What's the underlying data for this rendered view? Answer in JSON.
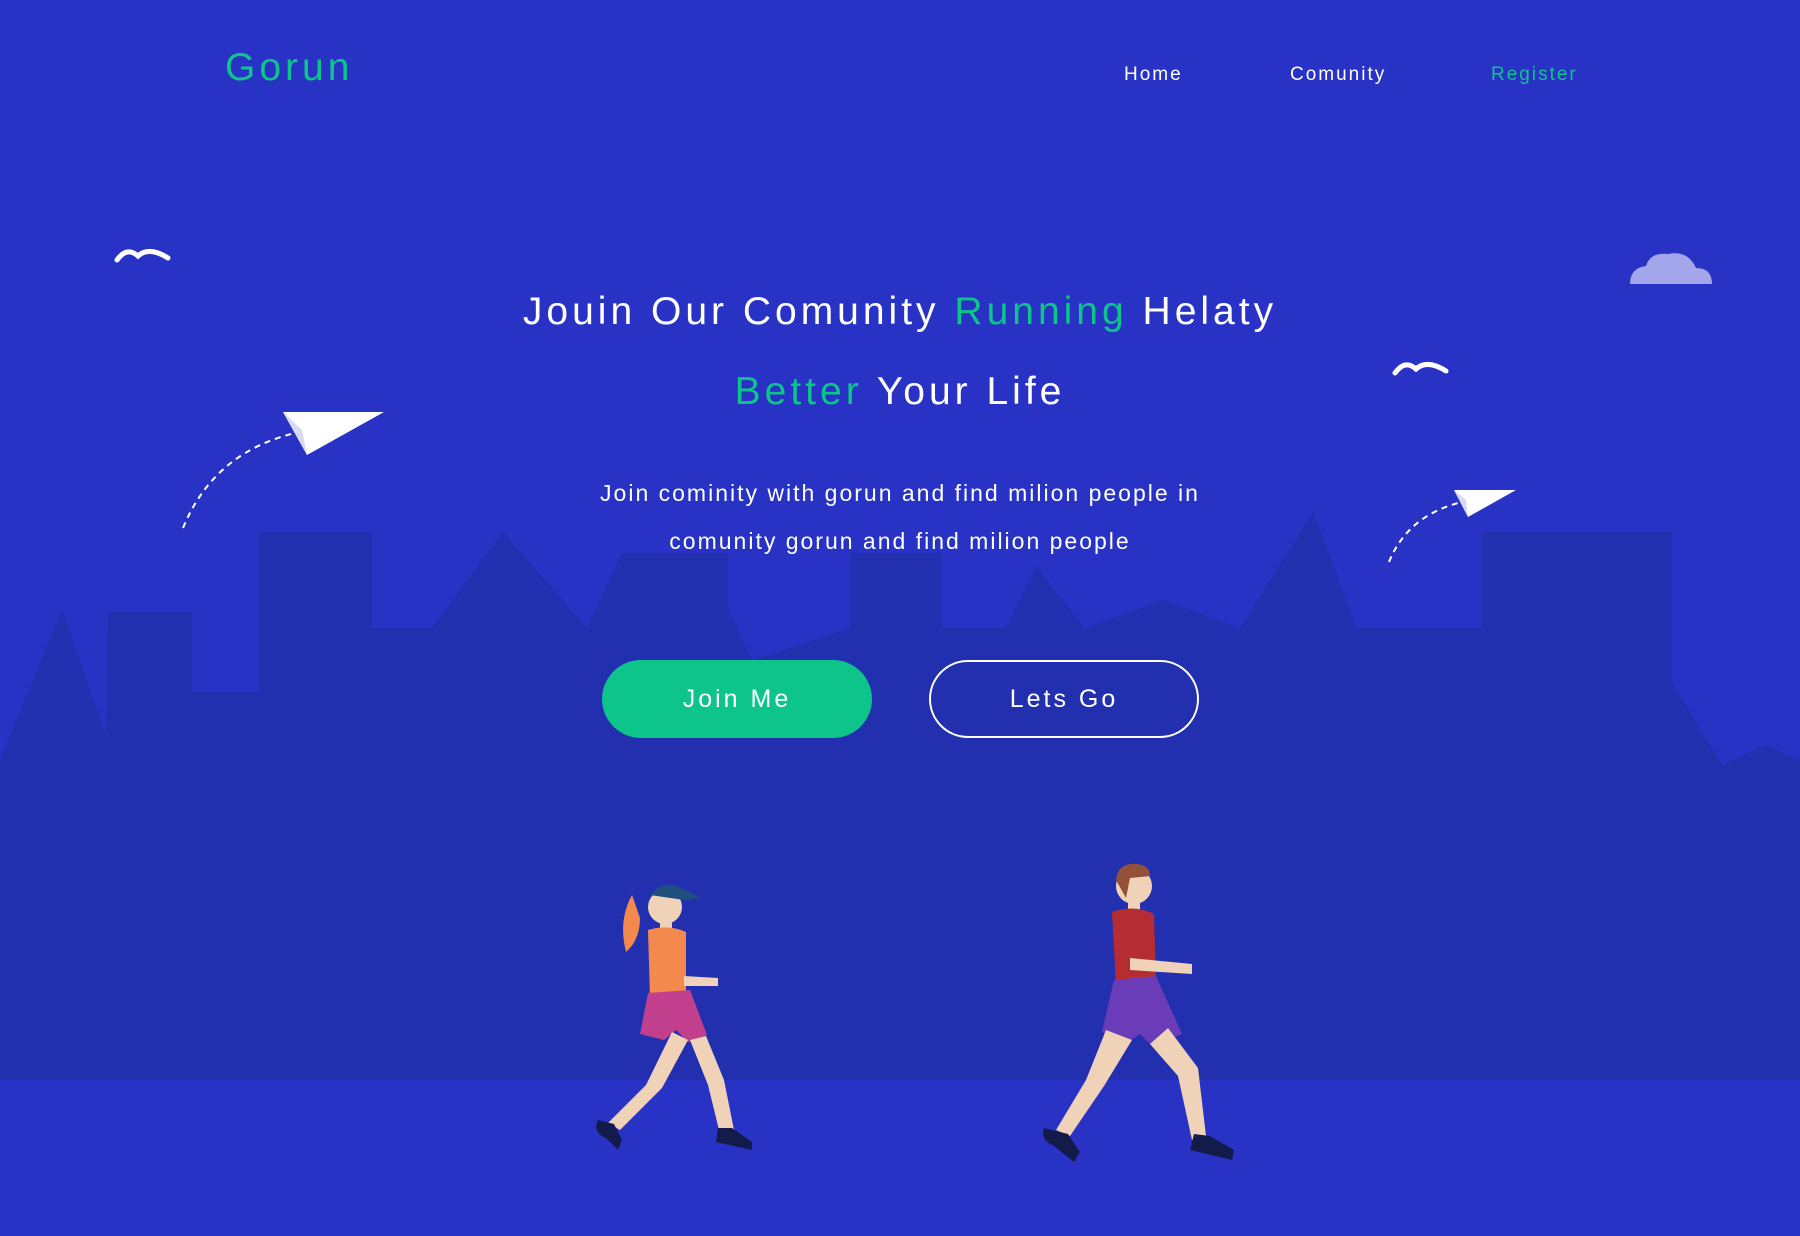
{
  "brand": {
    "name": "Gorun"
  },
  "nav": {
    "items": [
      {
        "label": "Home"
      },
      {
        "label": "Comunity"
      },
      {
        "label": "Register"
      }
    ]
  },
  "hero": {
    "title_part1": "Jouin Our Comunity ",
    "title_accent1": "Running",
    "title_part2": " Helaty",
    "title_accent2": "Better",
    "title_part3": " Your Life",
    "subtitle_line1": "Join cominity with gorun and find milion people in",
    "subtitle_line2": "comunity gorun and find milion people",
    "primary_button": "Join Me",
    "secondary_button": "Lets Go"
  },
  "colors": {
    "background": "#2833c6",
    "city_silhouette": "#2230b0",
    "accent": "#0dc48a",
    "text": "#ffffff",
    "cloud": "#a3a6ea"
  },
  "icons": [
    "bird-icon",
    "paper-plane-icon",
    "cloud-icon",
    "runner-woman",
    "runner-man"
  ]
}
